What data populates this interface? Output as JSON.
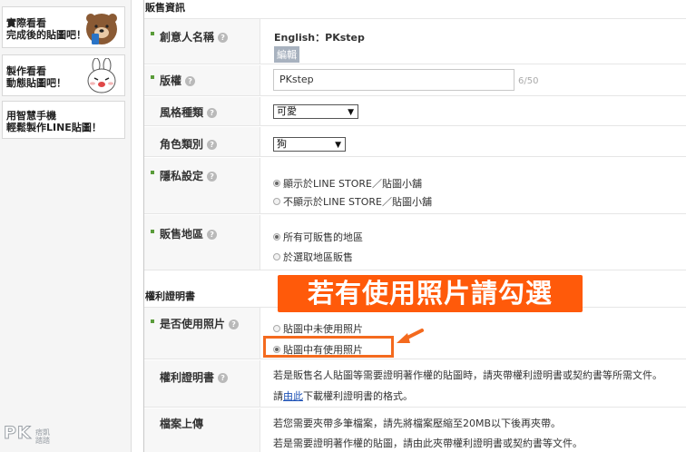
{
  "sidebar": {
    "promos": [
      {
        "line1": "實際看看",
        "line2": "完成後的貼圖吧！"
      },
      {
        "line1": "製作看看",
        "line2": "動態貼圖吧！"
      },
      {
        "line1": "用智慧手機",
        "line2": "輕鬆製作LINE貼圖！"
      }
    ]
  },
  "sales_section": {
    "title": "販售資訊",
    "creator": {
      "label": "創意人名稱",
      "value": "English：PKstep",
      "edit_label": "編輯"
    },
    "copyright": {
      "label": "版權",
      "value": "PKstep",
      "counter": "6/50"
    },
    "style": {
      "label": "風格種類",
      "selected": "可愛"
    },
    "character": {
      "label": "角色類別",
      "selected": "狗"
    },
    "privacy": {
      "label": "隱私設定",
      "options": [
        "顯示於LINE STORE／貼圖小舖",
        "不顯示於LINE STORE／貼圖小舖"
      ],
      "selected_index": 0
    },
    "region": {
      "label": "販售地區",
      "options": [
        "所有可販售的地區",
        "於選取地區販售"
      ],
      "selected_index": 0
    }
  },
  "rights_section": {
    "title": "權利證明書",
    "uses_photo": {
      "label": "是否使用照片",
      "options": [
        "貼圖中未使用照片",
        "貼圖中有使用照片"
      ],
      "selected_index": 1
    },
    "certificate": {
      "label": "權利證明書",
      "line1": "若是販售名人貼圖等需要證明著作權的貼圖時，請夾帶權利證明書或契約書等所需文件。",
      "line2_prefix": "請",
      "line2_link": "由此",
      "line2_suffix": "下載權利證明書的格式。"
    },
    "upload": {
      "label": "檔案上傳",
      "line1": "若您需要夾帶多筆檔案，請先將檔案壓縮至20MB以下後再夾帶。",
      "line2": "若是需要證明著作權的貼圖，請由此夾帶權利證明書或契約書等文件。"
    }
  },
  "annotation": {
    "callout": "若有使用照片請勾選",
    "accent_color": "#ff5a0a"
  },
  "watermark": {
    "logo": "PK",
    "sub1": "痞凱",
    "sub2": "踏踏"
  }
}
